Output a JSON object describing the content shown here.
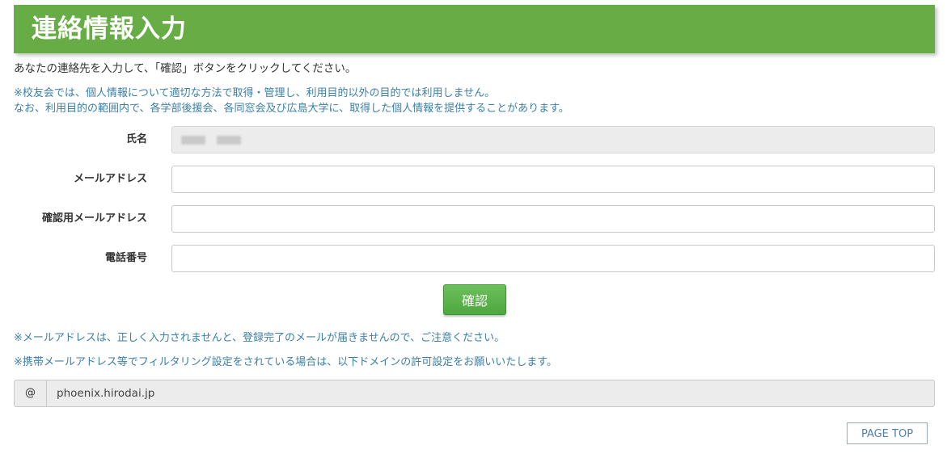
{
  "header": {
    "title": "連絡情報入力"
  },
  "intro": "あなたの連絡先を入力して、「確認」ボタンをクリックしてください。",
  "notice": {
    "line1": "※校友会では、個人情報について適切な方法で取得・管理し、利用目的以外の目的では利用しません。",
    "line2": "なお、利用目的の範囲内で、各学部後援会、各同窓会及び広島大学に、取得した個人情報を提供することがあります。"
  },
  "form": {
    "name": {
      "label": "氏名",
      "value": ""
    },
    "email": {
      "label": "メールアドレス",
      "value": ""
    },
    "email_confirm": {
      "label": "確認用メールアドレス",
      "value": ""
    },
    "phone": {
      "label": "電話番号",
      "value": ""
    }
  },
  "confirm_button": "確認",
  "warnings": {
    "line1": "※メールアドレスは、正しく入力されませんと、登録完了のメールが届きませんので、ご注意ください。",
    "line2": "※携帯メールアドレス等でフィルタリング設定をされている場合は、以下ドメインの許可設定をお願いいたします。"
  },
  "domain": {
    "prefix": "@",
    "value": "phoenix.hirodai.jp"
  },
  "page_top": "PAGE TOP",
  "colors": {
    "header_bg": "#67ac44",
    "button_bg": "#5cb34b",
    "note_text": "#3b7fa5"
  }
}
